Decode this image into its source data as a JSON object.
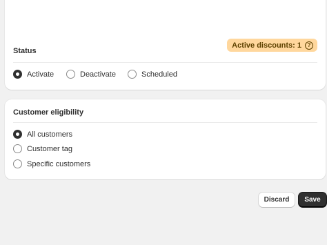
{
  "status_section": {
    "title": "Status",
    "badge_label": "Active discounts: 1",
    "badge_icon": "question-circle-icon",
    "options": [
      {
        "label": "Activate",
        "checked": true
      },
      {
        "label": "Deactivate",
        "checked": false
      },
      {
        "label": "Scheduled",
        "checked": false
      }
    ]
  },
  "eligibility_section": {
    "title": "Customer eligibility",
    "options": [
      {
        "label": "All customers",
        "checked": true
      },
      {
        "label": "Customer tag",
        "checked": false
      },
      {
        "label": "Specific customers",
        "checked": false
      }
    ]
  },
  "actions": {
    "discard_label": "Discard",
    "save_label": "Save"
  },
  "colors": {
    "badge_bg": "#ffd79d",
    "primary_button": "#303030",
    "page_bg": "#f1f1f1"
  }
}
